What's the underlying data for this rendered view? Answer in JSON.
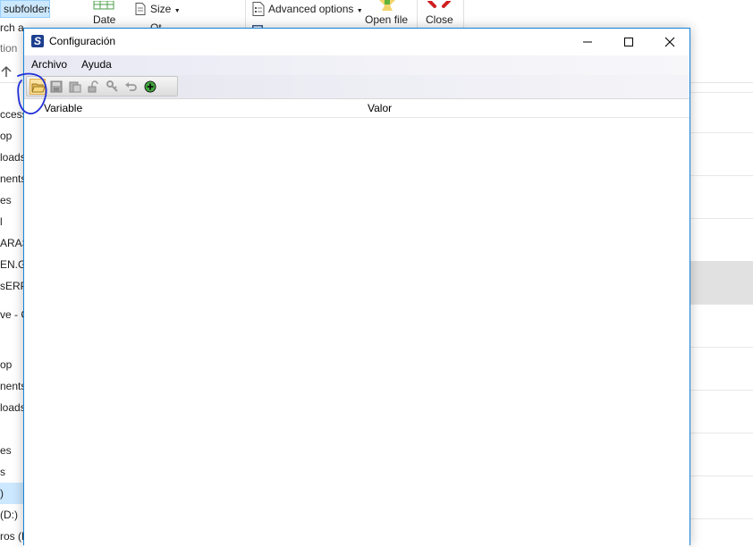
{
  "explorer": {
    "ribbon": {
      "include_subfolders": "subfolders",
      "search_again": "rch a",
      "option": "tion",
      "date": "Date",
      "size": "Size",
      "other_props": "Ot",
      "advanced_options": "Advanced options",
      "open_file": "Open file",
      "close": "Close"
    },
    "nav_items": [
      "ccess",
      "op",
      "loads",
      "nents",
      "es",
      "l",
      "ARAS",
      "EN.G",
      "sERP",
      "ve - C",
      "op",
      "nents",
      "loads",
      "es",
      "s",
      ")",
      "(D:)",
      "ros (E"
    ]
  },
  "dialog": {
    "title": "Configuración",
    "app_icon_letter": "S",
    "menu": [
      "Archivo",
      "Ayuda"
    ],
    "toolbar": {
      "buttons": [
        "open-folder",
        "save",
        "paste",
        "lock",
        "key",
        "undo",
        "add"
      ]
    },
    "grid": {
      "columns": [
        "Variable",
        "Valor"
      ],
      "rows": []
    }
  },
  "colors": {
    "dialog_border": "#1883d7",
    "selection": "#cce8ff",
    "annotation_ink": "#1f2fd6",
    "toolbar_active": "#fbe3a4"
  }
}
